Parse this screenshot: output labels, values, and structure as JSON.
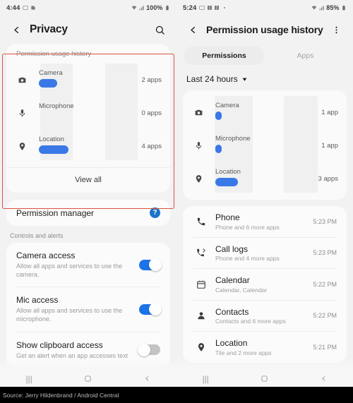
{
  "left": {
    "status": {
      "time": "4:44",
      "battery": "100%",
      "icons": [
        "cast-icon",
        "sim-icon"
      ]
    },
    "appbar": {
      "back": "back-icon",
      "title": "Privacy",
      "action": "search-icon"
    },
    "usage_card": {
      "label": "Permission usage history",
      "view_all": "View all",
      "rows": [
        {
          "icon": "camera-icon",
          "name": "Camera",
          "count": "2 apps",
          "bar": 26
        },
        {
          "icon": "microphone-icon",
          "name": "Microphone",
          "count": "0 apps",
          "bar": 0
        },
        {
          "icon": "location-icon",
          "name": "Location",
          "count": "4 apps",
          "bar": 42
        }
      ]
    },
    "permission_manager": {
      "title": "Permission manager",
      "help": "help-icon"
    },
    "controls_label": "Controls and alerts",
    "controls": [
      {
        "title": "Camera access",
        "sub": "Allow all apps and services to use the camera.",
        "state": "on"
      },
      {
        "title": "Mic access",
        "sub": "Allow all apps and services to use the microphone.",
        "state": "on"
      },
      {
        "title": "Show clipboard access",
        "sub": "Get an alert when an app accesses text",
        "state": "off"
      }
    ],
    "nav": [
      "recents-icon",
      "home-icon",
      "back-icon"
    ]
  },
  "right": {
    "status": {
      "time": "5:24",
      "battery": "85%",
      "icons": [
        "cast-icon",
        "nfc-icon",
        "nfc-icon",
        "dot-icon"
      ]
    },
    "appbar": {
      "back": "back-icon",
      "title": "Permission usage history",
      "action": "overflow-menu-icon"
    },
    "tabs": [
      {
        "label": "Permissions",
        "active": true
      },
      {
        "label": "Apps",
        "active": false
      }
    ],
    "period": {
      "label": "Last 24 hours",
      "chevron": "chevron-down-icon"
    },
    "usage_card": {
      "rows": [
        {
          "icon": "camera-icon",
          "name": "Camera",
          "count": "1 app",
          "bar": 9
        },
        {
          "icon": "microphone-icon",
          "name": "Microphone",
          "count": "1 app",
          "bar": 9
        },
        {
          "icon": "location-icon",
          "name": "Location",
          "count": "3 apps",
          "bar": 32
        }
      ]
    },
    "events": [
      {
        "icon": "phone-icon",
        "title": "Phone",
        "sub": "Phone and 6 more apps",
        "time": "5:23 PM"
      },
      {
        "icon": "call-log-icon",
        "title": "Call logs",
        "sub": "Phone and 4 more apps",
        "time": "5:23 PM"
      },
      {
        "icon": "calendar-icon",
        "title": "Calendar",
        "sub": "Calendar, Calendar",
        "time": "5:22 PM"
      },
      {
        "icon": "contacts-icon",
        "title": "Contacts",
        "sub": "Contacts and 6 more apps",
        "time": "5:22 PM"
      },
      {
        "icon": "location-icon",
        "title": "Location",
        "sub": "Tile and 2 more apps",
        "time": "5:21 PM"
      }
    ],
    "nav": [
      "recents-icon",
      "home-icon",
      "back-icon"
    ]
  },
  "chart_data": [
    {
      "type": "bar",
      "title": "Permission usage history",
      "categories": [
        "Camera",
        "Microphone",
        "Location"
      ],
      "values": [
        2,
        0,
        4
      ],
      "value_labels": [
        "2 apps",
        "0 apps",
        "4 apps"
      ],
      "xlabel": "",
      "ylabel": "apps",
      "orientation": "horizontal",
      "color": "#3b78e7",
      "panel": "left"
    },
    {
      "type": "bar",
      "title": "Last 24 hours",
      "categories": [
        "Camera",
        "Microphone",
        "Location"
      ],
      "values": [
        1,
        1,
        3
      ],
      "value_labels": [
        "1 app",
        "1 app",
        "3 apps"
      ],
      "xlabel": "",
      "ylabel": "apps",
      "orientation": "horizontal",
      "color": "#3b78e7",
      "panel": "right"
    }
  ],
  "source": "Source: Jerry Hildenbrand / Android Central",
  "colors": {
    "accent": "#1a73e8",
    "bar": "#3b78e7",
    "annotation": "#d9533c",
    "help": "#1a73c7"
  }
}
